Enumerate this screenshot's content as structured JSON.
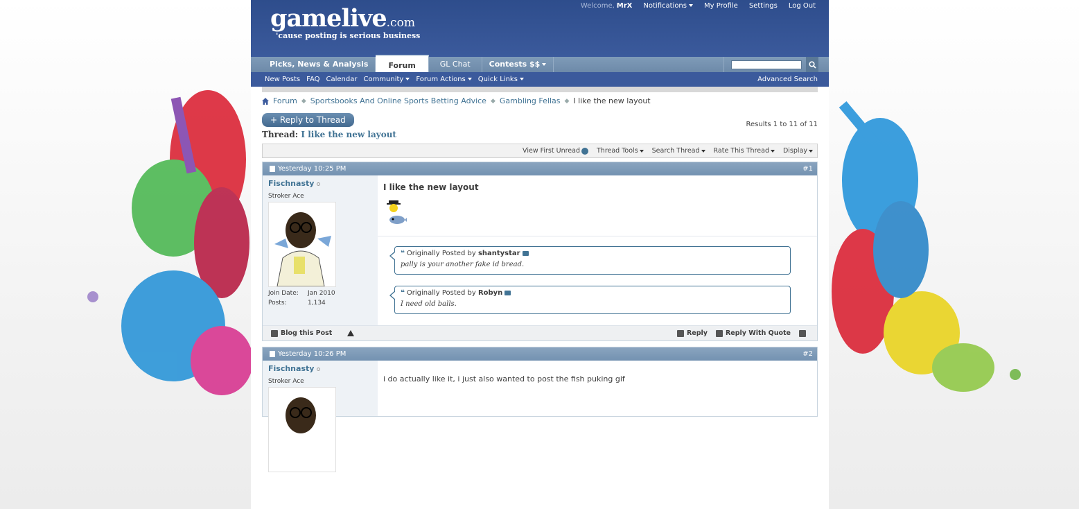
{
  "header": {
    "logo_main": "gamelive",
    "logo_domain": ".com",
    "tagline": "'cause posting is serious business",
    "welcome_label": "Welcome,",
    "username": "MrX",
    "links": [
      "Notifications",
      "My Profile",
      "Settings",
      "Log Out"
    ]
  },
  "nav": {
    "tabs": [
      "Picks, News & Analysis",
      "Forum",
      "GL Chat",
      "Contests $$"
    ],
    "search_placeholder": "",
    "subnav": [
      "New Posts",
      "FAQ",
      "Calendar",
      "Community",
      "Forum Actions",
      "Quick Links"
    ],
    "advanced_search": "Advanced Search"
  },
  "breadcrumb": [
    "Forum",
    "Sportsbooks And Online Sports Betting Advice",
    "Gambling Fellas",
    "I like the new layout"
  ],
  "reply_button": "+ Reply to Thread",
  "results": "Results 1 to 11 of 11",
  "thread": {
    "label": "Thread:",
    "title": "I like the new layout"
  },
  "toolbar": [
    "View First Unread",
    "Thread Tools",
    "Search Thread",
    "Rate This Thread",
    "Display"
  ],
  "posts": [
    {
      "date": "Yesterday 10:25 PM",
      "number": "#1",
      "username": "Fischnasty",
      "user_title": "Stroker Ace",
      "join_label": "Join Date:",
      "join_value": "Jan 2010",
      "posts_label": "Posts:",
      "posts_value": "1,134",
      "title": "I like the new layout",
      "quotes": [
        {
          "prefix": "Originally Posted by",
          "author": "shantystar",
          "text": "pally is your another fake id bread."
        },
        {
          "prefix": "Originally Posted by",
          "author": "Robyn",
          "text": "I need old balls."
        }
      ],
      "footer_left": "Blog this Post",
      "footer_right": [
        "Reply",
        "Reply With Quote"
      ]
    },
    {
      "date": "Yesterday 10:26 PM",
      "number": "#2",
      "username": "Fischnasty",
      "user_title": "Stroker Ace",
      "text": "i do actually like it, i just also wanted to post the fish puking gif"
    }
  ],
  "colors": {
    "header_blue": "#3b5a9c",
    "link_blue": "#417394"
  }
}
